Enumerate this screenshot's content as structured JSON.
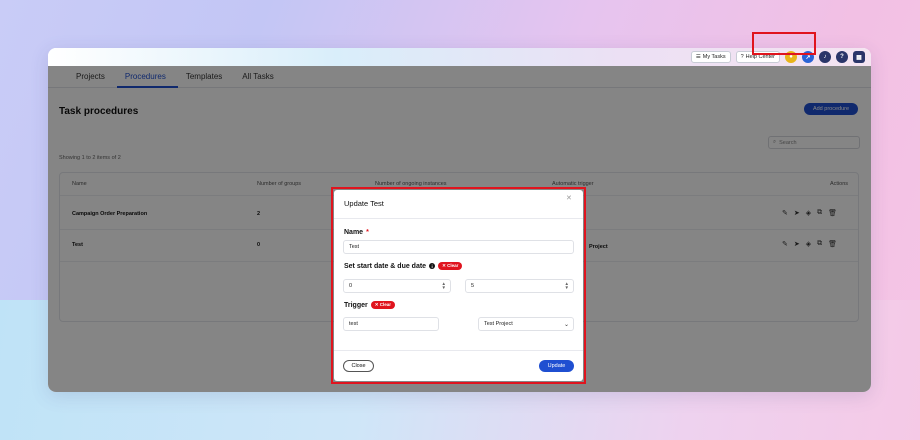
{
  "topbar": {
    "my_tasks": "My Tasks",
    "help_center": "Help Center",
    "icons": [
      "chat-icon",
      "rocket-icon",
      "bell-icon",
      "help-icon",
      "grid-icon"
    ]
  },
  "tabs": [
    {
      "label": "Projects",
      "active": false
    },
    {
      "label": "Procedures",
      "active": true
    },
    {
      "label": "Templates",
      "active": false
    },
    {
      "label": "All Tasks",
      "active": false
    }
  ],
  "page": {
    "title": "Task procedures",
    "add_button": "Add procedure",
    "search_placeholder": "Search",
    "showing": "Showing 1 to 2 items of 2"
  },
  "table": {
    "headers": [
      "Name",
      "Number of groups",
      "Number of ongoing instances",
      "Automatic trigger",
      "Actions"
    ],
    "rows": [
      {
        "name": "Campaign Order Preparation",
        "groups": "2",
        "trigger": ""
      },
      {
        "name": "Test",
        "groups": "0",
        "trigger": "Project"
      }
    ]
  },
  "modal": {
    "title": "Update Test",
    "name_label": "Name",
    "required_mark": "*",
    "name_value": "Test",
    "dates_label": "Set start date & due date",
    "clear_label": "Clear",
    "start_value": "0",
    "due_value": "5",
    "trigger_label": "Trigger",
    "trigger_text": "test",
    "trigger_project": "Test Project",
    "close_button": "Close",
    "update_button": "Update"
  },
  "colors": {
    "accent": "#1f4fd1",
    "highlight": "#e0141e"
  }
}
